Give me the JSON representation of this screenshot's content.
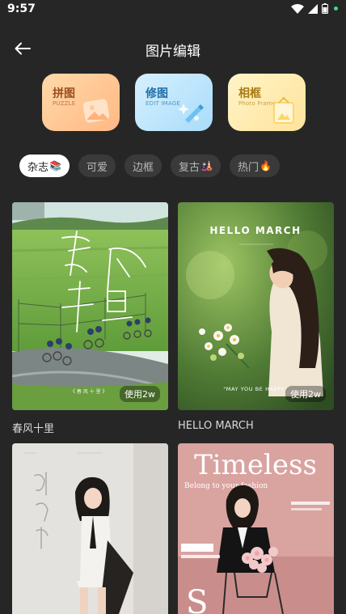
{
  "status": {
    "time": "9:57"
  },
  "header": {
    "title": "图片编辑",
    "back_icon": "arrow-left-icon"
  },
  "tools": [
    {
      "title": "拼图",
      "subtitle": "PUZZLE",
      "icon": "image-collage-icon"
    },
    {
      "title": "修图",
      "subtitle": "EDIT IMAGE",
      "icon": "sparkle-icon"
    },
    {
      "title": "相框",
      "subtitle": "Photo Frame",
      "icon": "frame-icon"
    }
  ],
  "filters": [
    {
      "label": "杂志",
      "emoji": "📚",
      "active": true
    },
    {
      "label": "可爱",
      "emoji": "",
      "active": false
    },
    {
      "label": "边框",
      "emoji": "",
      "active": false
    },
    {
      "label": "复古",
      "emoji": "🎎",
      "active": false
    },
    {
      "label": "热门",
      "emoji": "🔥",
      "active": false
    }
  ],
  "templates": [
    {
      "name": "春风十里",
      "usage": "使用2w",
      "poster_text": "春风十里"
    },
    {
      "name": "HELLO MARCH",
      "usage": "使用2w",
      "poster_text": "HELLO MARCH",
      "poster_sub": "\"MAY YOU BE HAPPY\""
    },
    {
      "name": "",
      "usage": "",
      "poster_text": ""
    },
    {
      "name": "",
      "usage": "",
      "poster_text": "Timeless",
      "poster_sub": "Belong to your fashion"
    }
  ]
}
